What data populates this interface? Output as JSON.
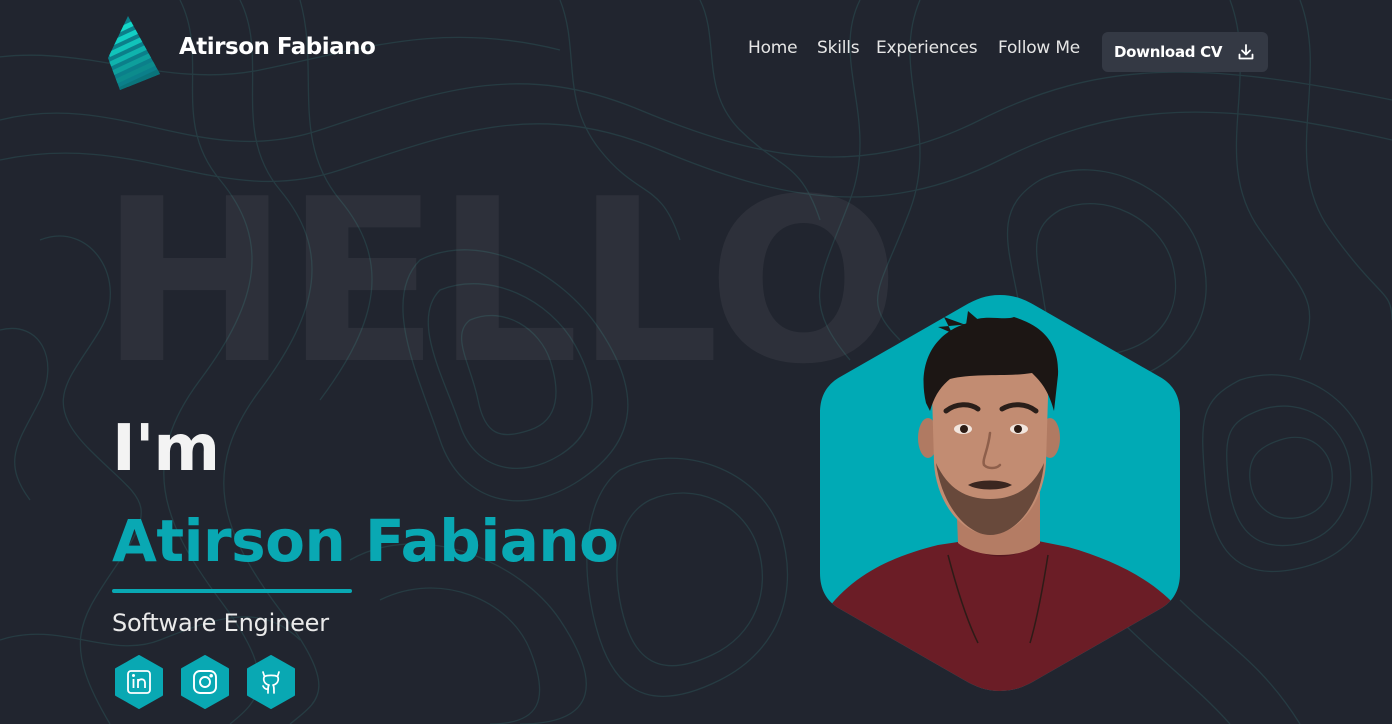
{
  "header": {
    "brand_name": "Atirson Fabiano",
    "nav": [
      {
        "label": "Home"
      },
      {
        "label": "Skills"
      },
      {
        "label": "Experiences"
      },
      {
        "label": "Follow Me"
      }
    ],
    "download_cv_label": "Download CV",
    "download_icon": "download-icon"
  },
  "hero": {
    "background_word": "HELLO",
    "greeting": "I'm",
    "name": "Atirson Fabiano",
    "role": "Software Engineer",
    "socials": [
      {
        "icon": "linkedin-icon"
      },
      {
        "icon": "instagram-icon"
      },
      {
        "icon": "github-icon"
      }
    ],
    "photo_alt": "profile-photo"
  },
  "colors": {
    "background": "#21252f",
    "accent": "#09a8b3",
    "button_bg": "#343944",
    "topo_lines": "#2a4247"
  }
}
